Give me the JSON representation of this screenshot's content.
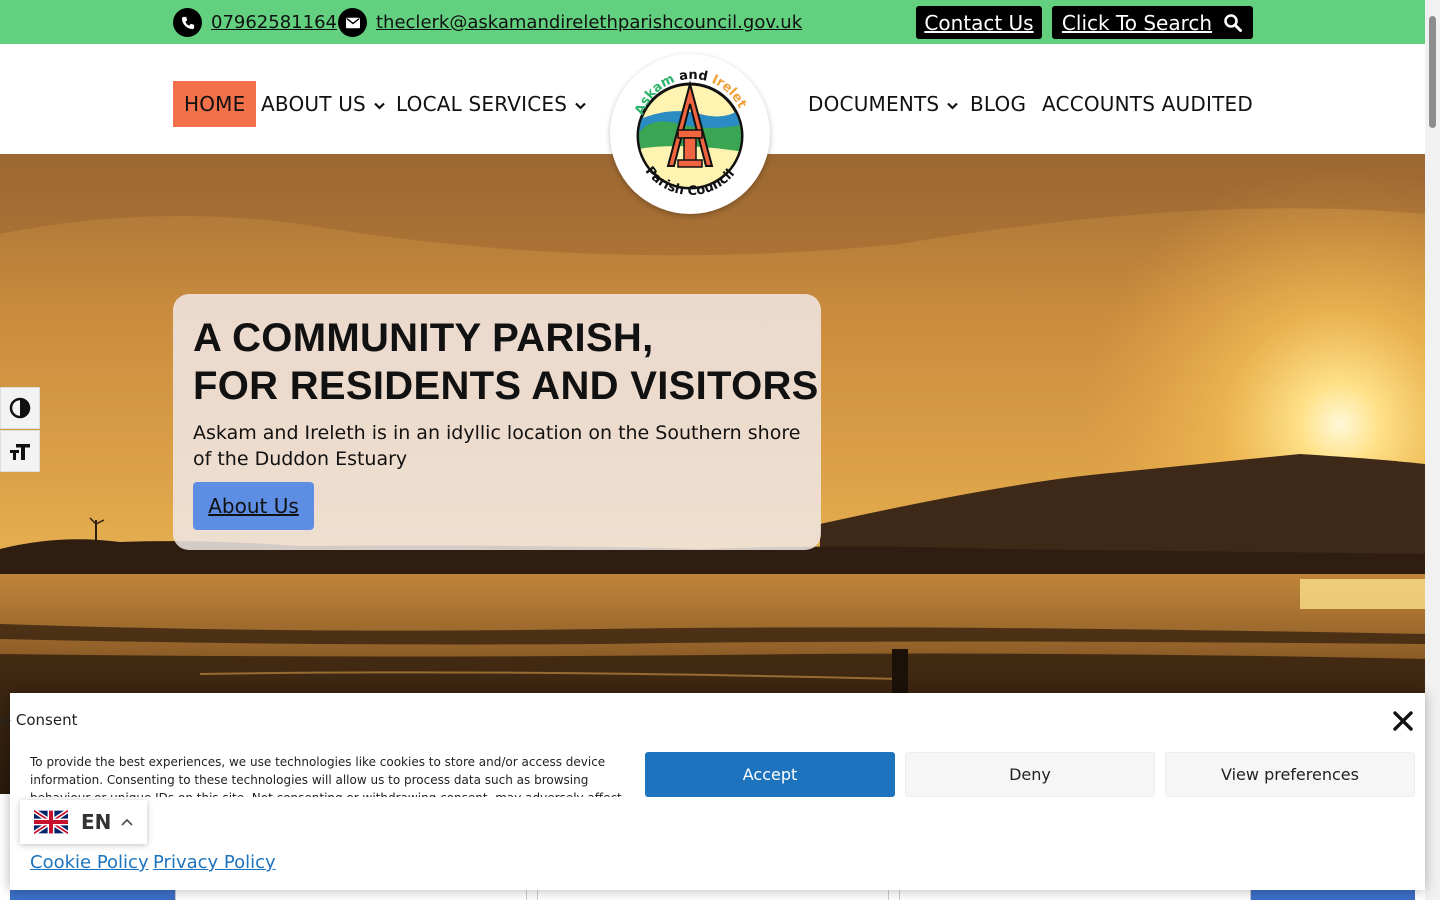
{
  "topbar": {
    "phone": "07962581164",
    "email": "theclerk@askamandirelethparishcouncil.gov.uk",
    "contact_button": "Contact Us",
    "search_button": "Click To Search",
    "bg_color": "#62d07f"
  },
  "nav": {
    "home": "HOME",
    "about": "ABOUT US",
    "services": "LOCAL SERVICES",
    "documents": "DOCUMENTS",
    "blog": "BLOG",
    "accounts": "ACCOUNTS AUDITED",
    "active_color": "#f2714a"
  },
  "logo": {
    "top_text_1": "Askam",
    "top_text_2": "and",
    "top_text_3": "Ireleth",
    "bottom_text": "Parish Council"
  },
  "hero": {
    "title_line1": "A COMMUNITY PARISH,",
    "title_line2": "FOR RESIDENTS AND VISITORS",
    "text": "Askam and Ireleth is in an idyllic location on the Southern shore of the Duddon Estuary",
    "button": "About Us"
  },
  "consent": {
    "title": "Manage Consent",
    "body": "To provide the best experiences, we use technologies like cookies to store and/or access device information. Consenting to these technologies will allow us to process data such as browsing behaviour or unique IDs on this site. Not consenting or withdrawing consent, may adversely affect certain features and functions.",
    "accept": "Accept",
    "deny": "Deny",
    "preferences": "View preferences",
    "cookie_policy": "Cookie Policy",
    "privacy_policy": "Privacy Policy",
    "accent_color": "#1e73be"
  },
  "language": {
    "code": "EN"
  }
}
